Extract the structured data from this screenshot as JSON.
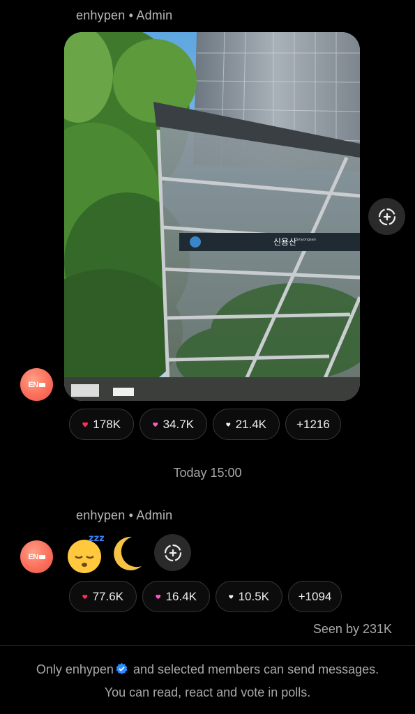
{
  "messages": [
    {
      "sender": "enhypen • Admin",
      "avatar_text": "EN",
      "reactions": [
        {
          "icon": "red-heart-icon",
          "count": "178K",
          "color": "#ff2d55"
        },
        {
          "icon": "pink-heart-icon",
          "count": "34.7K",
          "color": "#ff5ac8"
        },
        {
          "icon": "white-heart-icon",
          "count": "21.4K",
          "color": "#f5f5f5"
        }
      ],
      "more": "+1216"
    },
    {
      "sender": "enhypen • Admin",
      "avatar_text": "EN",
      "emojis": [
        "sleeping-face-emoji",
        "crescent-moon-emoji"
      ],
      "reactions": [
        {
          "icon": "red-heart-icon",
          "count": "77.6K",
          "color": "#ff2d55"
        },
        {
          "icon": "pink-heart-icon",
          "count": "16.4K",
          "color": "#ff5ac8"
        },
        {
          "icon": "white-heart-icon",
          "count": "10.5K",
          "color": "#f5f5f5"
        }
      ],
      "more": "+1094"
    }
  ],
  "date_separator": "Today 15:00",
  "seen_by": "Seen by 231K",
  "photo": {
    "sign_text": "신용산",
    "sign_sub": "Sinyongsan"
  },
  "footer": {
    "before": "Only enhypen",
    "after": "and selected members can send messages.",
    "line2": "You can read, react and vote in polls."
  },
  "colors": {
    "background": "#000000",
    "chip_border": "#353535",
    "avatar": "#fb6f5b",
    "verified": "#2d8cff"
  }
}
